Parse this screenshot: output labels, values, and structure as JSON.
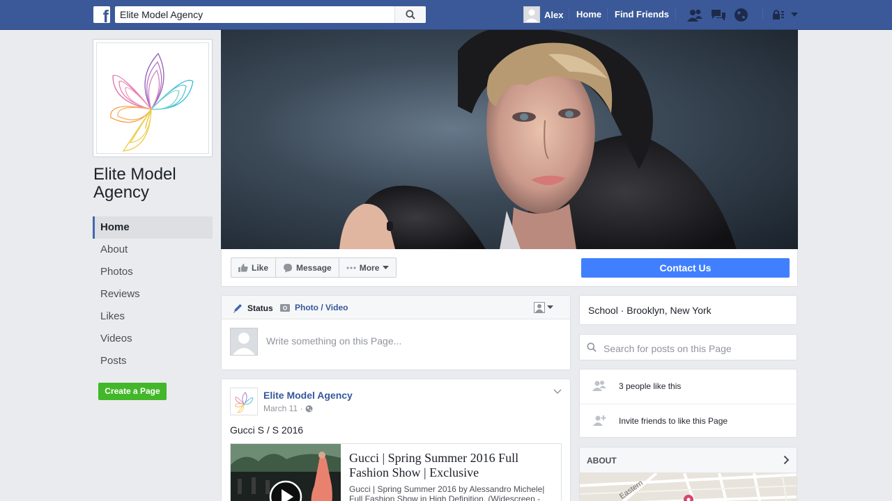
{
  "topbar": {
    "logo": "f",
    "search_value": "Elite Model Agency",
    "user_name": "Alex",
    "nav_home": "Home",
    "nav_find_friends": "Find Friends",
    "icons": [
      "friend-requests-icon",
      "messages-icon",
      "notifications-globe-icon",
      "privacy-lock-icon",
      "account-menu-chevron-icon"
    ]
  },
  "page": {
    "name": "Elite Model Agency",
    "nav": [
      "Home",
      "About",
      "Photos",
      "Reviews",
      "Likes",
      "Videos",
      "Posts"
    ],
    "active_nav": "Home",
    "create_page": "Create a Page"
  },
  "actions": {
    "like": "Like",
    "message": "Message",
    "more": "More",
    "contact": "Contact Us"
  },
  "composer": {
    "status": "Status",
    "photo_video": "Photo / Video",
    "placeholder": "Write something on this Page..."
  },
  "post": {
    "author": "Elite Model Agency",
    "date": "March 11 ·",
    "text": "Gucci S / S 2016",
    "link_title": "Gucci | Spring Summer 2016 Full Fashion Show | Exclusive",
    "link_desc": "Gucci | Spring Summer 2016 by Alessandro Michele| Full Fashion Show in High Definition. (Widescreen -"
  },
  "sidebar": {
    "category": "School · Brooklyn, New York",
    "search_placeholder": "Search for posts on this Page",
    "likes_count": "3 people like this",
    "invite": "Invite friends to like this Page",
    "about_heading": "ABOUT",
    "map_label": "Eastern"
  },
  "colors": {
    "brand_blue": "#3b5998",
    "link_blue": "#365899",
    "contact_blue": "#4080ff",
    "create_green": "#42b72a",
    "background": "#e9ebee"
  }
}
